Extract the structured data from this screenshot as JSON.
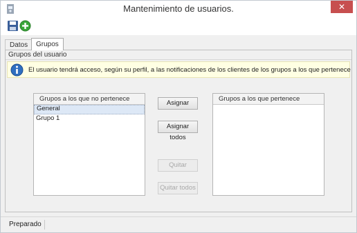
{
  "window": {
    "title": "Mantenimiento de usuarios.",
    "close_glyph": "✕"
  },
  "toolbar": {
    "icons": [
      "save-icon",
      "add-icon"
    ]
  },
  "tabs": [
    {
      "label": "Datos",
      "active": false
    },
    {
      "label": "Grupos",
      "active": true
    }
  ],
  "group": {
    "header": "Grupos del usuario",
    "info": "El usuario tendrá acceso, según su perfil, a las notificaciones de los clientes de los grupos a los que pertenece"
  },
  "lists": {
    "not_member": {
      "header": "Grupos a los que no pertenece",
      "items": [
        "General",
        "Grupo 1"
      ]
    },
    "member": {
      "header": "Grupos a los que pertenece",
      "items": []
    }
  },
  "buttons": {
    "assign": "Asignar",
    "assign_all": "Asignar todos",
    "remove": "Quitar",
    "remove_all": "Quitar todos"
  },
  "status": {
    "text": "Preparado"
  },
  "colors": {
    "close": "#c74f4f",
    "info_background": "#ffffe3",
    "info_icon": "#2f6fc0",
    "add_icon": "#3aa63a"
  }
}
